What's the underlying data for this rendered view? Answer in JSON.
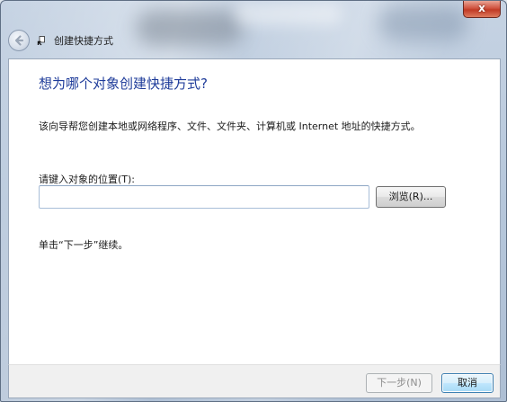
{
  "window": {
    "title": "创建快捷方式",
    "close_label": "x"
  },
  "page": {
    "heading": "想为哪个对象创建快捷方式?",
    "description": "该向导帮您创建本地或网络程序、文件、文件夹、计算机或 Internet 地址的快捷方式。",
    "location_label": "请键入对象的位置(T):",
    "location_value": "",
    "browse_label": "浏览(R)...",
    "hint": "单击“下一步”继续。"
  },
  "footer": {
    "next_label": "下一步(N)",
    "cancel_label": "取消",
    "next_enabled": false
  },
  "icons": {
    "back": "back-arrow-icon",
    "wizard": "shortcut-wizard-icon",
    "close": "close-icon"
  },
  "colors": {
    "heading": "#1f3c9a",
    "close_button": "#c13a25",
    "default_button_border": "#3c7fb1"
  }
}
